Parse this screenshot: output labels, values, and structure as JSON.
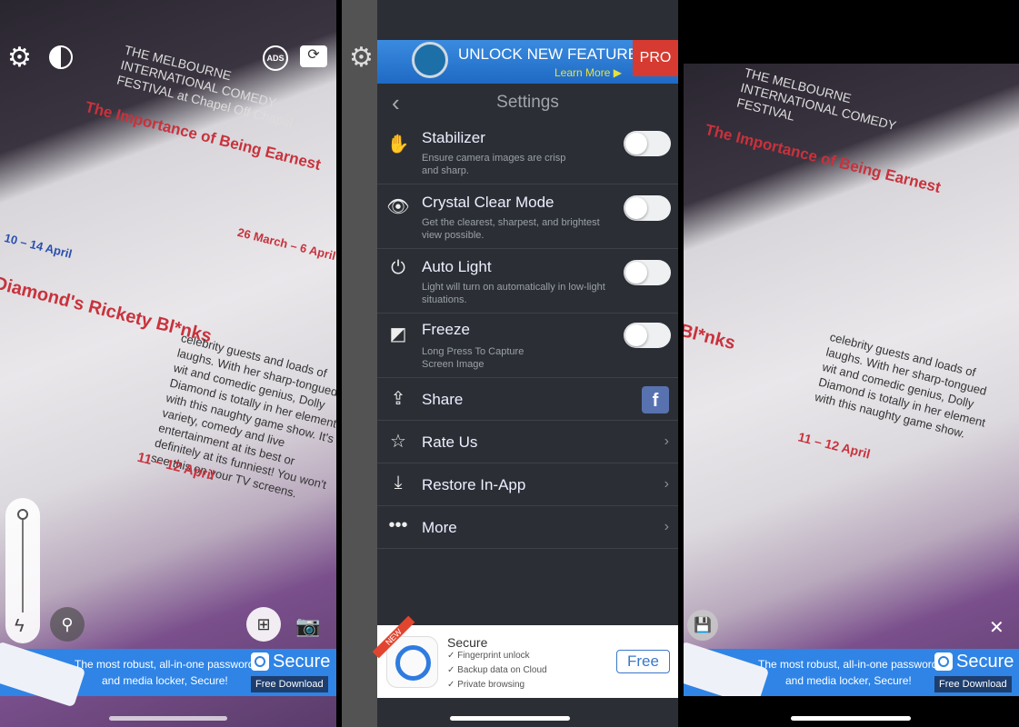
{
  "left_panel": {
    "magazine": {
      "festival": "THE MELBOURNE INTERNATIONAL COMEDY FESTIVAL at Chapel Off Chapel",
      "show1": "The Importance of Being Earnest",
      "dates1": "26 March – 6 April",
      "dates0": "10 – 14 April",
      "show2": "Diamond's Rickety Bl*nks",
      "dates2": "11 – 12 April",
      "body": "celebrity guests and loads of laughs. With her sharp-tongued wit and comedic genius, Dolly Diamond is totally in her element with this naughty game show. It's variety, comedy and live entertainment at its best or definitely at its funniest! You won't see this on your TV screens."
    },
    "icons": [
      "gear-icon",
      "contrast-icon",
      "no-ads-icon",
      "switch-camera-icon",
      "flash-icon",
      "magnifier-icon",
      "crop-icon",
      "camera-icon"
    ]
  },
  "ad_banner": {
    "line1": "The most robust, all-in-one password",
    "line2": "and media locker, Secure!",
    "brand": "Secure",
    "download": "Free Download",
    "color": "#2f84e6"
  },
  "settings": {
    "promo": {
      "title": "UNLOCK NEW FEATURES",
      "link": "Learn More ▶",
      "badge": "PRO"
    },
    "header": {
      "title": "Settings"
    },
    "toggles": [
      {
        "title": "Stabilizer",
        "desc": "Ensure camera images are crisp and sharp.",
        "icon": "stabilizer-hand-icon",
        "on": false
      },
      {
        "title": "Crystal Clear Mode",
        "desc": "Get the clearest, sharpest, and brightest view possible.",
        "icon": "eye-icon",
        "on": false
      },
      {
        "title": "Auto Light",
        "desc": "Light will turn on automatically in low-light situations.",
        "icon": "power-icon",
        "on": false
      },
      {
        "title": "Freeze",
        "desc": "Long Press To Capture Screen Image",
        "icon": "freeze-frame-icon",
        "on": false
      }
    ],
    "links": [
      {
        "title": "Share",
        "icon": "share-icon"
      },
      {
        "title": "Rate Us",
        "icon": "star-icon"
      },
      {
        "title": "Restore In-App",
        "icon": "download-icon"
      },
      {
        "title": "More",
        "icon": "more-dots-icon"
      }
    ],
    "ad": {
      "ribbon": "NEW",
      "title": "Secure",
      "features": [
        "Fingerprint unlock",
        "Backup data on Cloud",
        "Private browsing"
      ],
      "button": "Free"
    }
  },
  "right_panel": {
    "icons": [
      "save-icon",
      "close-icon"
    ]
  }
}
